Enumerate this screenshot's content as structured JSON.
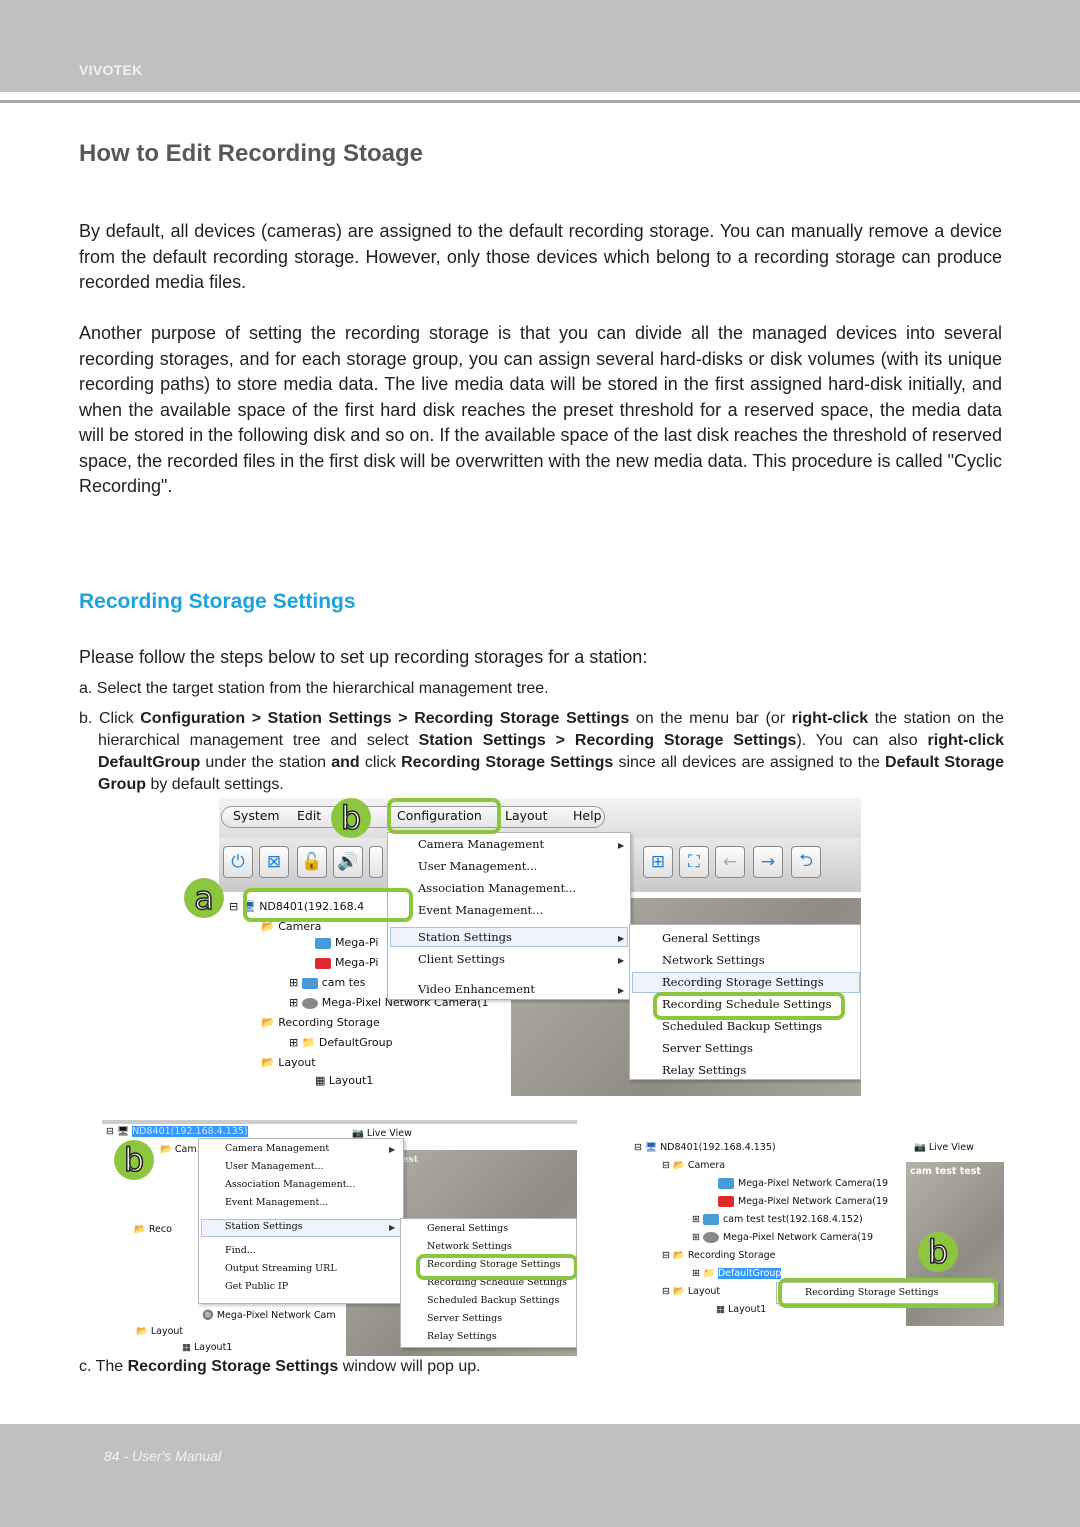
{
  "header": {
    "brand": "VIVOTEK"
  },
  "title": "How to Edit Recording Stoage",
  "paragraphs": [
    "By default, all devices (cameras) are assigned to the default recording storage. You can manually remove a device from the default recording storage. However, only those devices which belong to a recording storage can produce recorded media files.",
    "Another purpose of setting the recording storage is that you can divide all the managed devices into several recording storages, and for each storage group, you can assign several hard-disks or disk volumes (with its unique recording paths) to store media data. The live media data will be stored in the first assigned hard-disk initially, and when the available space of the first hard disk reaches the preset threshold for a reserved space, the media data will be stored in the following disk and so on. If the available space of the last disk reaches the threshold of reserved space, the recorded files in the first disk will be overwritten with the new media data. This procedure is called \"Cyclic Recording\"."
  ],
  "section": {
    "title": "Recording Storage Settings",
    "intro": "Please follow the steps below to set up recording storages for a station:",
    "step_a": "a. Select the target station from the hierarchical management tree.",
    "step_b": {
      "t1": "b. Click ",
      "b1": "Configuration > Station Settings > Recording Storage Settings",
      "t2": " on the menu bar (or ",
      "b2": "right-click",
      "t3": " the station on the hierarchical management tree and select ",
      "b3": "Station Settings > Recording Storage Settings",
      "t4": "). You can also ",
      "b4": "right-click DefaultGroup",
      "t5": " under the station ",
      "b5": "and",
      "t6": " click ",
      "b6": "Recording Storage Settings",
      "t7": " since all devices are assigned to the ",
      "b7": "Default Storage Group",
      "t8": " by default settings."
    },
    "step_c": {
      "t1": "c. The ",
      "b1": "Recording Storage Settings",
      "t2": " window will pop up."
    }
  },
  "screenshot1": {
    "menubar": [
      "System",
      "Edit",
      "Configuration",
      "Layout",
      "Help"
    ],
    "toolbar_icons": [
      "power-icon",
      "disconnect-icon",
      "lock-icon",
      "speaker-icon",
      "layout-grid-icon",
      "fullscreen-icon",
      "back-arrow-icon",
      "forward-arrow-icon",
      "return-icon"
    ],
    "config_menu": [
      "Camera Management",
      "User Management...",
      "Association Management...",
      "Event Management...",
      "Station Settings",
      "Client Settings",
      "Video Enhancement"
    ],
    "station_submenu": [
      "General Settings",
      "Network Settings",
      "Recording Storage Settings",
      "Recording Schedule Settings",
      "Scheduled Backup Settings",
      "Server Settings",
      "Relay Settings"
    ],
    "tree": {
      "station": "ND8401(192.168.4",
      "camera_folder": "Camera",
      "cameras": [
        "Mega-Pi",
        "Mega-Pi",
        "cam tes",
        "Mega-Pixel Network Camera(1"
      ],
      "recording_storage": "Recording Storage",
      "default_group": "DefaultGroup",
      "layout_folder": "Layout",
      "layout1": "Layout1"
    },
    "badges": {
      "a": "a",
      "b": "b"
    }
  },
  "screenshot2": {
    "station": "ND8401(192.168.4.135)",
    "tab": "Live View",
    "context_menu": [
      "Camera Management",
      "User Management...",
      "Association Management...",
      "Event Management...",
      "Station Settings",
      "Find...",
      "Output Streaming URL",
      "Get Public IP"
    ],
    "submenu": [
      "General Settings",
      "Network Settings",
      "Recording Storage Settings",
      "Recording Schedule Settings",
      "Scheduled Backup Settings",
      "Server Settings",
      "Relay Settings"
    ],
    "tree_partial": [
      "Cam",
      "Reco",
      "Mega-Pixel Network Cam",
      "Layout",
      "Layout1"
    ],
    "video_label": "test",
    "badge": "b"
  },
  "screenshot3": {
    "station": "ND8401(192.168.4.135)",
    "camera_folder": "Camera",
    "cameras": [
      "Mega-Pixel Network Camera(19",
      "Mega-Pixel Network Camera(19",
      "cam test test(192.168.4.152)",
      "Mega-Pixel Network Camera(19"
    ],
    "recording_storage": "Recording Storage",
    "default_group": "DefaultGroup",
    "layout_folder": "Layout",
    "layout1": "Layout1",
    "tab": "Live View",
    "video_label": "cam test test",
    "context_item": "Recording Storage Settings",
    "badge": "b"
  },
  "footer": {
    "text": "84 - User's Manual"
  }
}
